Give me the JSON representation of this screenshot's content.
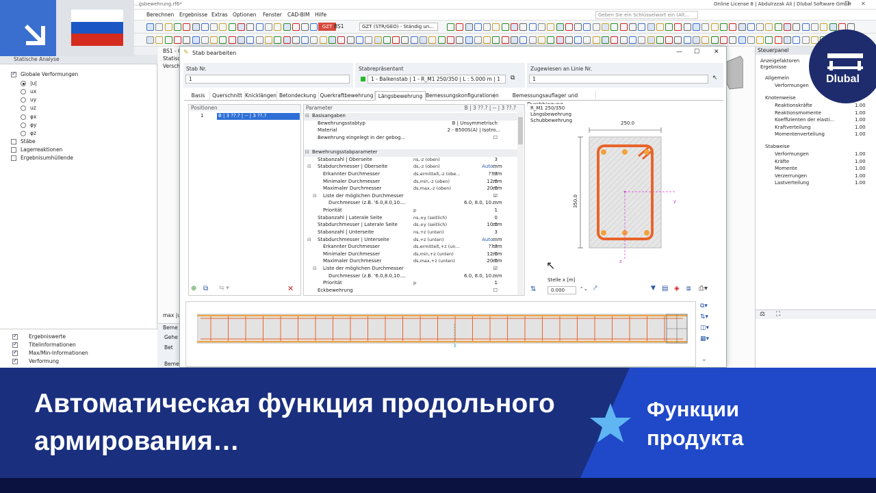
{
  "app": {
    "file_title": "...gsbewehrung.rf6*",
    "license": "Online License 8 | Abdulrzzak Ali | Dlubal Software GmbH",
    "search_placeholder": "Geben Sie ein Schlüsselwort ein (Alt...",
    "menu": [
      "Berechnen",
      "Ergebnisse",
      "Extras",
      "Optionen",
      "Fenster",
      "CAD-BIM",
      "Hilfe"
    ],
    "toolbar": {
      "gzt": "GZT",
      "bs1": "BS1",
      "combo": "GZT (STR/GEO) - Ständig un..."
    }
  },
  "nav": {
    "header": "Statische Analyse",
    "tree": [
      {
        "label": "Globale Verformungen",
        "type": "check",
        "on": true
      },
      {
        "label": "|u|",
        "type": "radio",
        "on": true
      },
      {
        "label": "ux",
        "type": "radio",
        "on": false
      },
      {
        "label": "uy",
        "type": "radio",
        "on": false
      },
      {
        "label": "uz",
        "type": "radio",
        "on": false
      },
      {
        "label": "φx",
        "type": "radio",
        "on": false
      },
      {
        "label": "φy",
        "type": "radio",
        "on": false
      },
      {
        "label": "φz",
        "type": "radio",
        "on": false
      },
      {
        "label": "Stäbe",
        "type": "check",
        "on": false
      },
      {
        "label": "Lagerreaktionen",
        "type": "check",
        "on": false
      },
      {
        "label": "Ergebnisumhüllende",
        "type": "check",
        "on": false
      }
    ],
    "lower": [
      {
        "label": "Ergebniswerte",
        "on": true
      },
      {
        "label": "Titelinformationen",
        "on": true
      },
      {
        "label": "Max/Min-Informationen",
        "on": true
      },
      {
        "label": "Verformung",
        "on": true
      }
    ],
    "max_label": "max |u|"
  },
  "viewport": {
    "bs_label": "BS1 - G",
    "lines": [
      "Statisch",
      "Verschi"
    ],
    "bottom_bar": "Beme",
    "goto": "Gehe z",
    "bet": "Bet",
    "beme2": "Beme"
  },
  "control_panel": {
    "header": "Steuerpanel",
    "sub1": "Anzeigefaktoren",
    "sub2": "Ergebnisse",
    "groups": [
      {
        "title": "Allgemein",
        "rows": [
          {
            "label": "Verformungen",
            "value": "1.00"
          }
        ]
      },
      {
        "title": "Knotenweise",
        "rows": [
          {
            "label": "Reaktionskräfte",
            "value": "1.00"
          },
          {
            "label": "Reaktionsmomente",
            "value": "1.00"
          },
          {
            "label": "Koeffizienten der elasti...",
            "value": "1.00"
          },
          {
            "label": "Kraftverteilung",
            "value": "1.00"
          },
          {
            "label": "Momentenverteilung",
            "value": "1.00"
          }
        ]
      },
      {
        "title": "Stabweise",
        "rows": [
          {
            "label": "Verformungen",
            "value": "1.00"
          },
          {
            "label": "Kräfte",
            "value": "1.00"
          },
          {
            "label": "Momente",
            "value": "1.00"
          },
          {
            "label": "Verzerrungen",
            "value": "1.00"
          },
          {
            "label": "Lastverteilung",
            "value": "1.00"
          }
        ]
      }
    ]
  },
  "dialog": {
    "title": "Stab bearbeiten",
    "stab_nr_label": "Stab Nr.",
    "stab_nr": "1",
    "rep_label": "Stabrepräsentant",
    "rep_value": "1 - Balkenstab | 1 - R_M1 250/350 | L : 5.000 m | 1",
    "assigned_label": "Zugewiesen an Linie Nr.",
    "assigned_value": "1",
    "tabs": [
      "Basis",
      "Querschnitt",
      "Knicklängen",
      "Betondeckung",
      "Querkraftbewehrung",
      "Längsbewehrung",
      "Bemessungskonfigurationen",
      "Bemessungsauflager und Durchbiegung"
    ],
    "active_tab": "Längsbewehrung",
    "positions_header": "Positionen",
    "position_row": {
      "nr": "1",
      "text": "B | 3 ??.? | -- | 3 ??.?"
    },
    "param_header": "Parameter",
    "param_header_right": "B | 3 ??.? | -- | 3 ??.?",
    "params": [
      {
        "l": "Basisangaben",
        "grp": true,
        "ind": 0
      },
      {
        "l": "Bewehrungsstabtyp",
        "s": "",
        "v": "B | Unsymmetrisch",
        "u": "",
        "ind": 1
      },
      {
        "l": "Material",
        "s": "",
        "v": "2 - B500S(A) | Isotro...",
        "u": "",
        "ind": 1
      },
      {
        "l": "Bewehrung eingelegt in der gebog...",
        "s": "",
        "v": "☐",
        "u": "",
        "ind": 1
      },
      {
        "l": "",
        "grp": false,
        "ind": 0
      },
      {
        "l": "Bewehrungsstabparameter",
        "grp": true,
        "ind": 0
      },
      {
        "l": "Stabanzahl | Oberseite",
        "s": "ns,-z (oben)",
        "v": "3",
        "u": "",
        "ind": 1
      },
      {
        "l": "Stabdurchmesser | Oberseite",
        "s": "ds,-z (oben)",
        "v": "Auto...",
        "u": "mm",
        "ind": 1
      },
      {
        "l": "Erkannter Durchmesser",
        "s": "ds,ermittelt,-z (obe...",
        "v": "??.?",
        "u": "mm",
        "ind": 2
      },
      {
        "l": "Minimaler Durchmesser",
        "s": "ds,min,-z (oben)",
        "v": "12.0",
        "u": "mm",
        "ind": 2
      },
      {
        "l": "Maximaler Durchmesser",
        "s": "ds,max,-z (oben)",
        "v": "20.0",
        "u": "mm",
        "ind": 2
      },
      {
        "l": "Liste der möglichen Durchmesser",
        "s": "",
        "v": "☑",
        "u": "",
        "ind": 2
      },
      {
        "l": "Durchmesser (z.B. '6.0,8.0,10....",
        "s": "",
        "v": "6.0, 8.0, 10....",
        "u": "mm",
        "ind": 3
      },
      {
        "l": "Priorität",
        "s": "p",
        "v": "1",
        "u": "",
        "ind": 2
      },
      {
        "l": "Stabanzahl | Laterale Seite",
        "s": "ns,±y (seitlich)",
        "v": "0",
        "u": "",
        "ind": 1
      },
      {
        "l": "Stabdurchmesser | Laterale Seite",
        "s": "ds,±y (seitlich)",
        "v": "10.0",
        "u": "mm",
        "ind": 1
      },
      {
        "l": "Stabanzahl | Unterseite",
        "s": "ns,+z (unten)",
        "v": "3",
        "u": "",
        "ind": 1
      },
      {
        "l": "Stabdurchmesser | Unterseite",
        "s": "ds,+z (unten)",
        "v": "Auto...",
        "u": "mm",
        "ind": 1
      },
      {
        "l": "Erkannter Durchmesser",
        "s": "ds,ermittelt,+z (un...",
        "v": "??.?",
        "u": "mm",
        "ind": 2
      },
      {
        "l": "Minimaler Durchmesser",
        "s": "ds,min,+z (unten)",
        "v": "12.0",
        "u": "mm",
        "ind": 2
      },
      {
        "l": "Maximaler Durchmesser",
        "s": "ds,max,+z (unten)",
        "v": "20.0",
        "u": "mm",
        "ind": 2
      },
      {
        "l": "Liste der möglichen Durchmesser",
        "s": "",
        "v": "☑",
        "u": "",
        "ind": 2
      },
      {
        "l": "Durchmesser (z.B. '6.0,8.0,10....",
        "s": "",
        "v": "6.0, 8.0, 10....",
        "u": "mm",
        "ind": 3
      },
      {
        "l": "Priorität",
        "s": "p",
        "v": "1",
        "u": "",
        "ind": 2
      },
      {
        "l": "Eckbewehrung",
        "s": "",
        "v": "☐",
        "u": "",
        "ind": 1
      }
    ],
    "section": {
      "name": "R_M1 250/350",
      "line2": "Längsbewehrung",
      "line3": "Schubbewehrung",
      "width": "250.0",
      "height": "350.0",
      "axis_y": "y",
      "axis_z": "z",
      "stelle_label": "Stelle x [m]",
      "stelle_value": "0.000"
    }
  },
  "banner": {
    "title": "Автоматическая функция продольного армирования…",
    "right": "Функции продукта",
    "brand": "Dlubal"
  },
  "colors": {
    "banner": "#1a2f7e",
    "flag_blue": "#1a56c4",
    "flag_red": "#d52b1e",
    "rebar": "#e8642a",
    "bar_orange": "#f2a23a",
    "brand_blue": "#1e2c6e"
  }
}
